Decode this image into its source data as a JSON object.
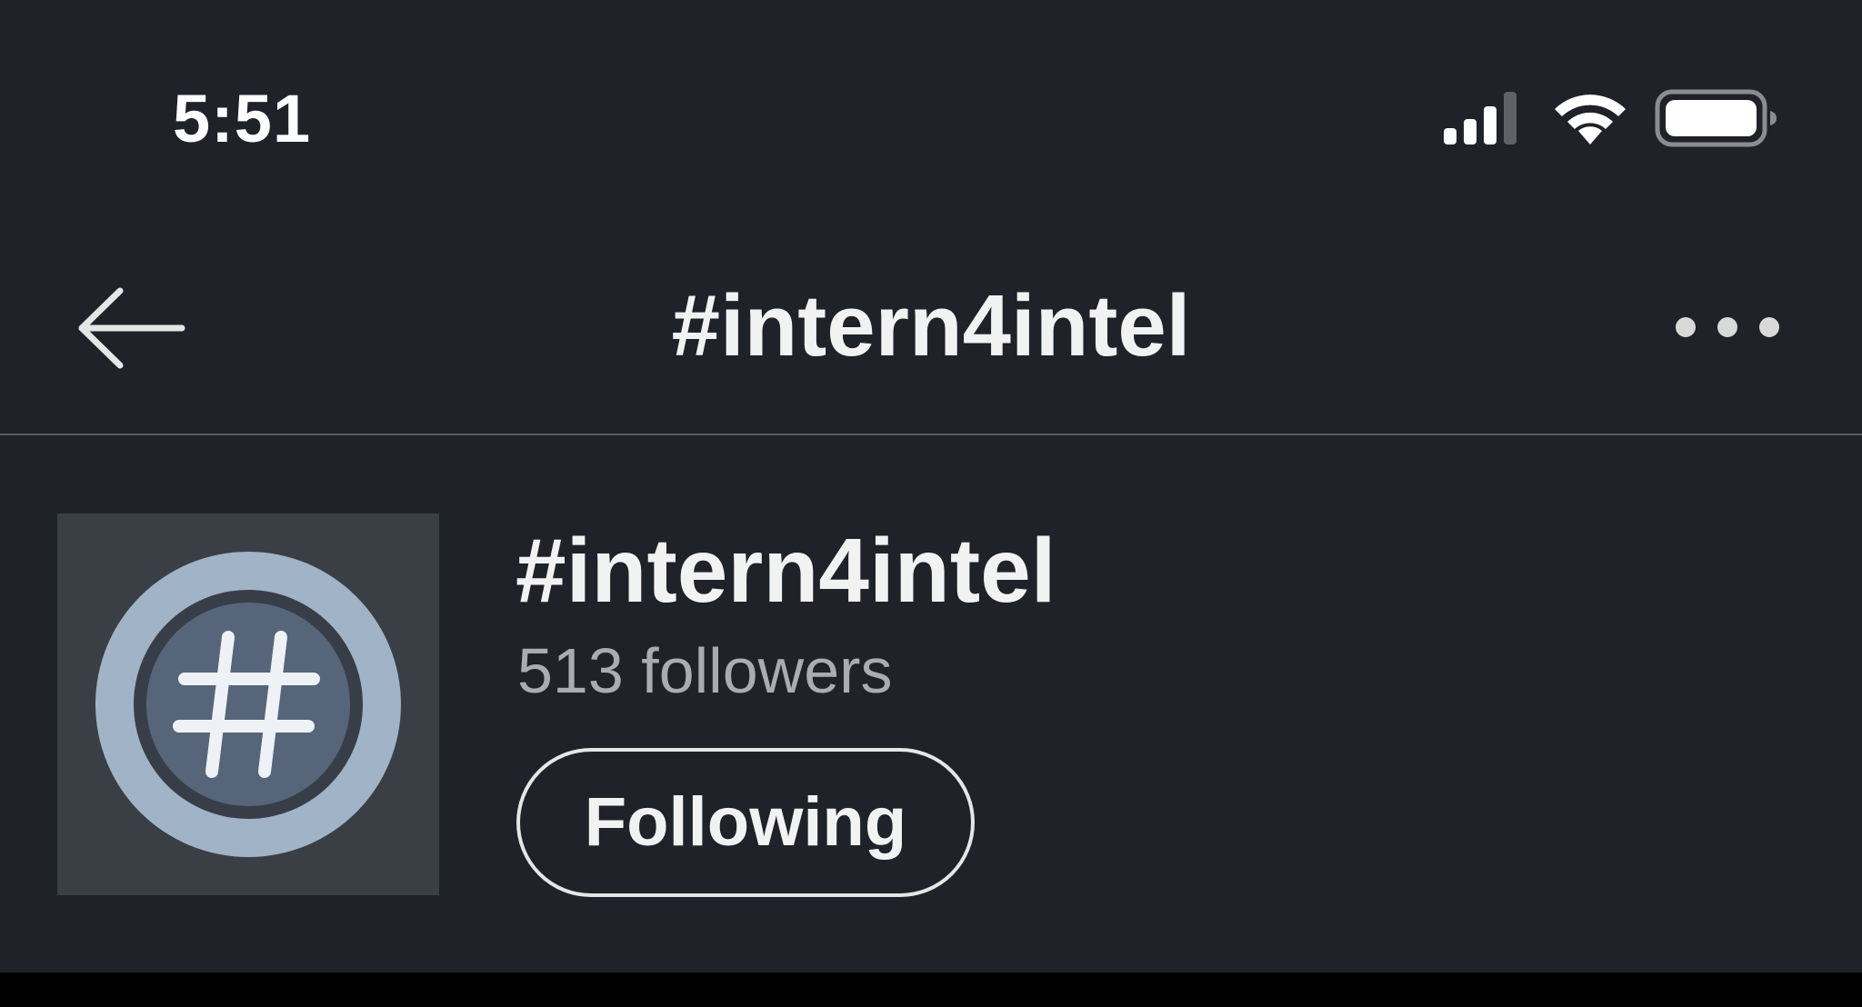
{
  "status_bar": {
    "time": "5:51",
    "icons": [
      "cellular-signal-icon",
      "wifi-icon",
      "battery-icon"
    ]
  },
  "nav": {
    "back_icon": "arrow-left-icon",
    "title": "#intern4intel",
    "more_icon": "more-horizontal-icon"
  },
  "hashtag": {
    "name": "#intern4intel",
    "followers": "513 followers",
    "avatar_icon": "hashtag-icon",
    "follow_button_label": "Following"
  },
  "colors": {
    "background": "#1f2228",
    "text_primary": "#f2f2f2",
    "text_secondary": "#a9adb3",
    "avatar_bg": "#3a3f45",
    "avatar_ring": "#a1b3c7",
    "avatar_core": "#56657a"
  }
}
